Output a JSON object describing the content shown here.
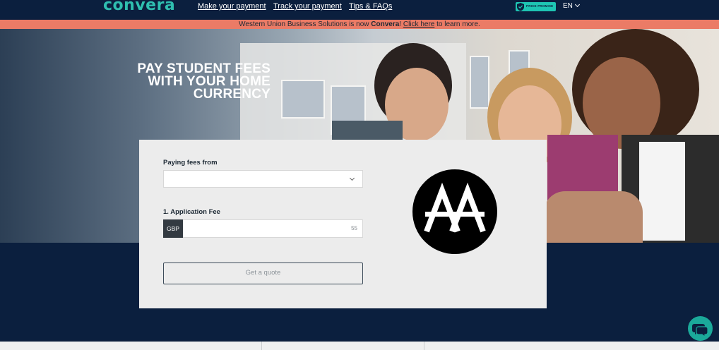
{
  "header": {
    "logo": "convera",
    "nav": [
      {
        "label": "Make your payment"
      },
      {
        "label": "Track your payment"
      },
      {
        "label": "Tips & FAQs"
      }
    ],
    "badge_text": "PRICE PROMISE",
    "language": "EN"
  },
  "banner": {
    "prefix": "Western Union Business Solutions is now ",
    "brand": "Convera",
    "sep": "! ",
    "link": "Click here",
    "suffix": " to learn more."
  },
  "hero": {
    "title": "PAY STUDENT FEES WITH YOUR HOME CURRENCY"
  },
  "form": {
    "paying_from_label": "Paying fees from",
    "paying_from_value": "",
    "fee_label": "1. Application Fee",
    "currency": "GBP",
    "amount": "55",
    "quote_button": "Get a quote"
  },
  "icons": {
    "chevron": "chevron-down-icon",
    "shield": "shield-check-icon",
    "chat": "chat-bubbles-icon",
    "university": "university-logo"
  },
  "colors": {
    "navy": "#0b1f3e",
    "teal": "#1ba99a",
    "banner": "#eb7b66",
    "card": "#ececec"
  }
}
